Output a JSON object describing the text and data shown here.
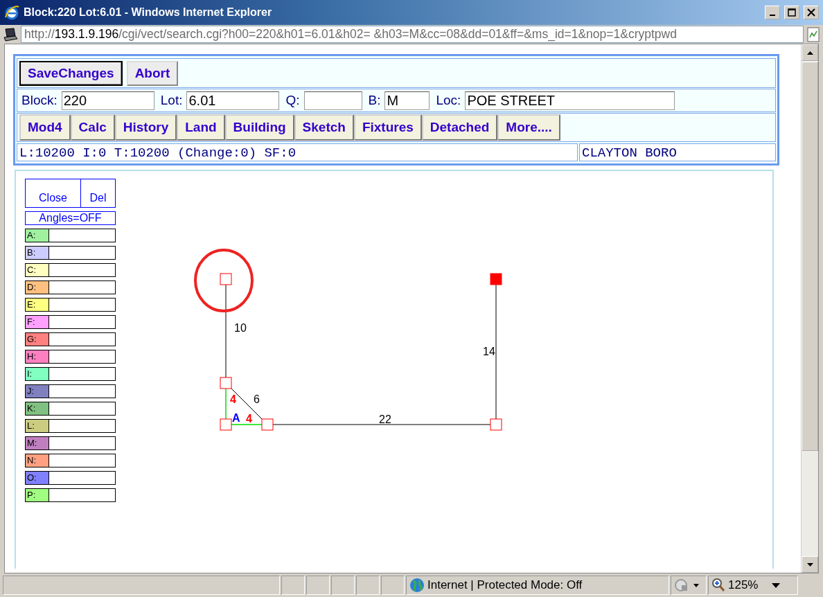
{
  "window": {
    "title": "Block:220 Lot:6.01 - Windows Internet Explorer"
  },
  "address": {
    "scheme": "http://",
    "host": "193.1.9.196",
    "path": "/cgi/vect/search.cgi?h00=220&h01=6.01&h02= &h03=M&cc=08&dd=01&ff=&ms_id=1&nop=1&cryptpwd"
  },
  "actions": [
    "SaveChanges",
    "Abort"
  ],
  "fields": [
    {
      "label": "Block:",
      "value": "220"
    },
    {
      "label": "Lot:",
      "value": "6.01"
    },
    {
      "label": "Q:"
    },
    {
      "label": "B:",
      "value": "M"
    },
    {
      "label": "Loc:",
      "value": "POE STREET"
    }
  ],
  "tabs": [
    "Mod4",
    "Calc",
    "History",
    "Land",
    "Building",
    "Sketch",
    "Fixtures",
    "Detached",
    "More...."
  ],
  "summary": {
    "values": "L:10200 I:0 T:10200 (Change:0) SF:0",
    "municipality": "CLAYTON BORO"
  },
  "sketch_tools": {
    "buttons": [
      "Close",
      "Del"
    ],
    "angles": "Angles=OFF"
  },
  "sections": [
    {
      "label": "A:",
      "color": "#a0f0a0"
    },
    {
      "label": "B:",
      "color": "#ccccff"
    },
    {
      "label": "C:",
      "color": "#ffffc0"
    },
    {
      "label": "D:",
      "color": "#ffc080"
    },
    {
      "label": "E:",
      "color": "#ffff80"
    },
    {
      "label": "F:",
      "color": "#ffa0ff"
    },
    {
      "label": "G:",
      "color": "#ff8080"
    },
    {
      "label": "H:",
      "color": "#ff80c0"
    },
    {
      "label": "I:",
      "color": "#80ffc0"
    },
    {
      "label": "J:",
      "color": "#8080c0"
    },
    {
      "label": "K:",
      "color": "#80c080"
    },
    {
      "label": "L:",
      "color": "#cccc80"
    },
    {
      "label": "M:",
      "color": "#c080c0"
    },
    {
      "label": "N:",
      "color": "#ffa080"
    },
    {
      "label": "O:",
      "color": "#8080ff"
    },
    {
      "label": "P:",
      "color": "#a0ff80"
    }
  ],
  "drawing": {
    "vertices": [
      {
        "selected": false
      },
      {
        "selected": true
      },
      {
        "selected": false
      },
      {
        "selected": false
      },
      {
        "selected": false
      },
      {
        "selected": false
      }
    ],
    "labels": [
      {
        "text": "10",
        "kind": "dimension"
      },
      {
        "text": "14",
        "kind": "dimension"
      },
      {
        "text": "6",
        "kind": "dimension"
      },
      {
        "text": "4",
        "kind": "section-dimension"
      },
      {
        "text": "A",
        "kind": "section-name"
      },
      {
        "text": "4",
        "kind": "section-dimension"
      },
      {
        "text": "22",
        "kind": "dimension"
      }
    ]
  },
  "status_bar": {
    "zone": "Internet | Protected Mode: Off",
    "zoom": "125%"
  }
}
